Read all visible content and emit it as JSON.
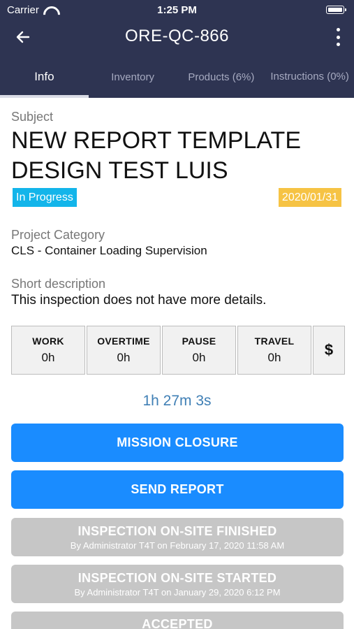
{
  "status_bar": {
    "carrier": "Carrier",
    "time": "1:25 PM"
  },
  "navbar": {
    "title": "ORE-QC-866"
  },
  "tabs": [
    {
      "label": "Info"
    },
    {
      "label": "Inventory"
    },
    {
      "label": "Products (6%)"
    },
    {
      "label": "Instructions (0%)"
    }
  ],
  "subject": {
    "label": "Subject",
    "title": "NEW REPORT TEMPLATE DESIGN TEST LUIS",
    "status": "In Progress",
    "date": "2020/01/31"
  },
  "project_category": {
    "label": "Project Category",
    "value": "CLS - Container Loading Supervision"
  },
  "short_description": {
    "label": "Short description",
    "value": "This inspection does not have more details."
  },
  "timers": [
    {
      "label": "WORK",
      "value": "0h"
    },
    {
      "label": "OVERTIME",
      "value": "0h"
    },
    {
      "label": "PAUSE",
      "value": "0h"
    },
    {
      "label": "TRAVEL",
      "value": "0h"
    }
  ],
  "cost_symbol": "$",
  "elapsed": "1h 27m 3s",
  "actions": {
    "mission_closure": "MISSION CLOSURE",
    "send_report": "SEND REPORT"
  },
  "history": [
    {
      "label": "INSPECTION ON-SITE FINISHED",
      "sub": "By Administrator T4T on February 17, 2020 11:58 AM"
    },
    {
      "label": "INSPECTION ON-SITE STARTED",
      "sub": "By Administrator T4T on January 29, 2020 6:12 PM"
    },
    {
      "label": "ACCEPTED",
      "sub": ""
    }
  ],
  "colors": {
    "header_bg": "#2e3452",
    "primary": "#1a8cff",
    "status_badge": "#13b5ea",
    "date_badge": "#f6c344",
    "disabled": "#c6c6c6",
    "elapsed": "#3f7fb5"
  },
  "icons": {
    "back": "back-arrow-icon",
    "menu": "more-vertical-icon",
    "wifi": "wifi-icon",
    "battery": "battery-icon"
  }
}
